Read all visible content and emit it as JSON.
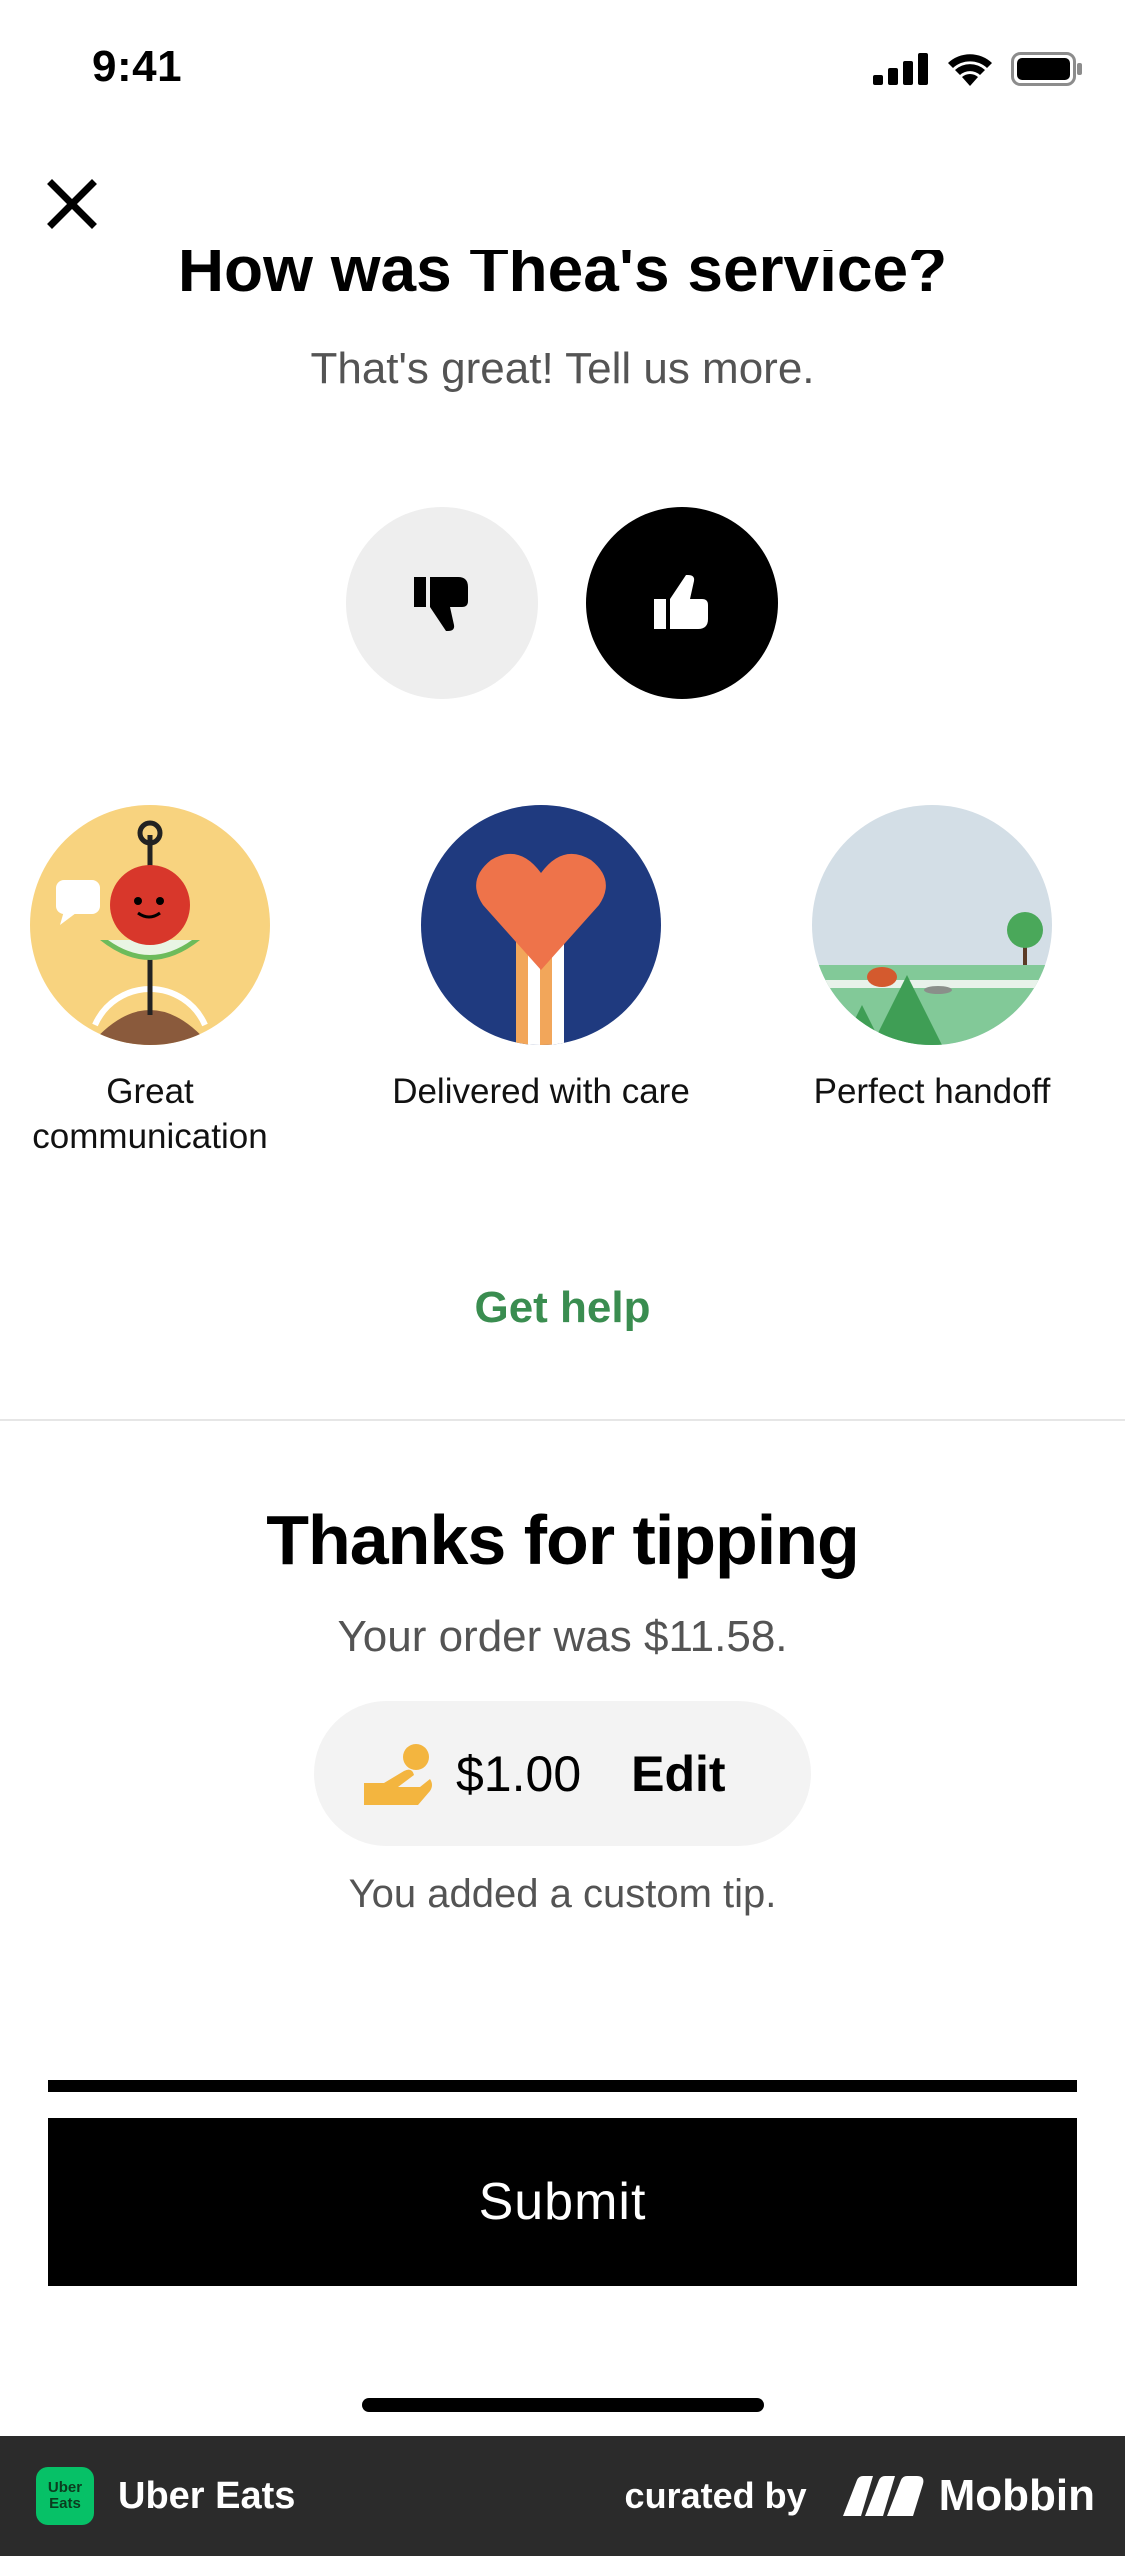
{
  "status_bar": {
    "time": "9:41"
  },
  "rating": {
    "heading": "How was Thea's service?",
    "subtext": "That's great! Tell us more."
  },
  "compliments": [
    {
      "label": "Great communication",
      "icon": "chat-tomato-illustration"
    },
    {
      "label": "Delivered with care",
      "icon": "heart-illustration"
    },
    {
      "label": "Perfect handoff",
      "icon": "landscape-illustration"
    }
  ],
  "get_help": "Get help",
  "tip": {
    "title": "Thanks for tipping",
    "order_total": "Your order was $11.58.",
    "amount": "$1.00",
    "edit": "Edit",
    "note": "You added a custom tip."
  },
  "submit_label": "Submit",
  "footer": {
    "badge_line1": "Uber",
    "badge_line2": "Eats",
    "app_name": "Uber Eats",
    "curated_by": "curated by",
    "brand": "Mobbin"
  },
  "colors": {
    "accent_green": "#3a8d50",
    "tip_icon": "#f3b53f",
    "badge_green": "#06c167"
  }
}
